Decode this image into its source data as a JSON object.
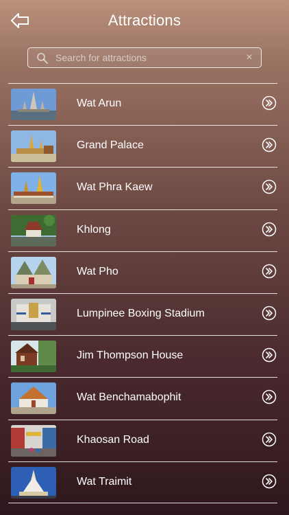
{
  "header": {
    "title": "Attractions",
    "back_icon": "back-arrow-icon"
  },
  "search": {
    "placeholder": "Search for attractions",
    "value": "",
    "clear_glyph": "×",
    "icon": "search-icon"
  },
  "list": {
    "items": [
      {
        "label": "Wat Arun",
        "thumb": "wat-arun"
      },
      {
        "label": "Grand Palace",
        "thumb": "grand-palace"
      },
      {
        "label": "Wat Phra Kaew",
        "thumb": "wat-phra-kaew"
      },
      {
        "label": "Khlong",
        "thumb": "khlong"
      },
      {
        "label": "Wat Pho",
        "thumb": "wat-pho"
      },
      {
        "label": "Lumpinee Boxing Stadium",
        "thumb": "lumpinee"
      },
      {
        "label": "Jim Thompson House",
        "thumb": "jim-thompson"
      },
      {
        "label": "Wat Benchamabophit",
        "thumb": "wat-benchamabophit"
      },
      {
        "label": "Khaosan Road",
        "thumb": "khaosan-road"
      },
      {
        "label": "Wat Traimit",
        "thumb": "wat-traimit"
      }
    ],
    "row_icon": "double-chevron-right-icon"
  }
}
